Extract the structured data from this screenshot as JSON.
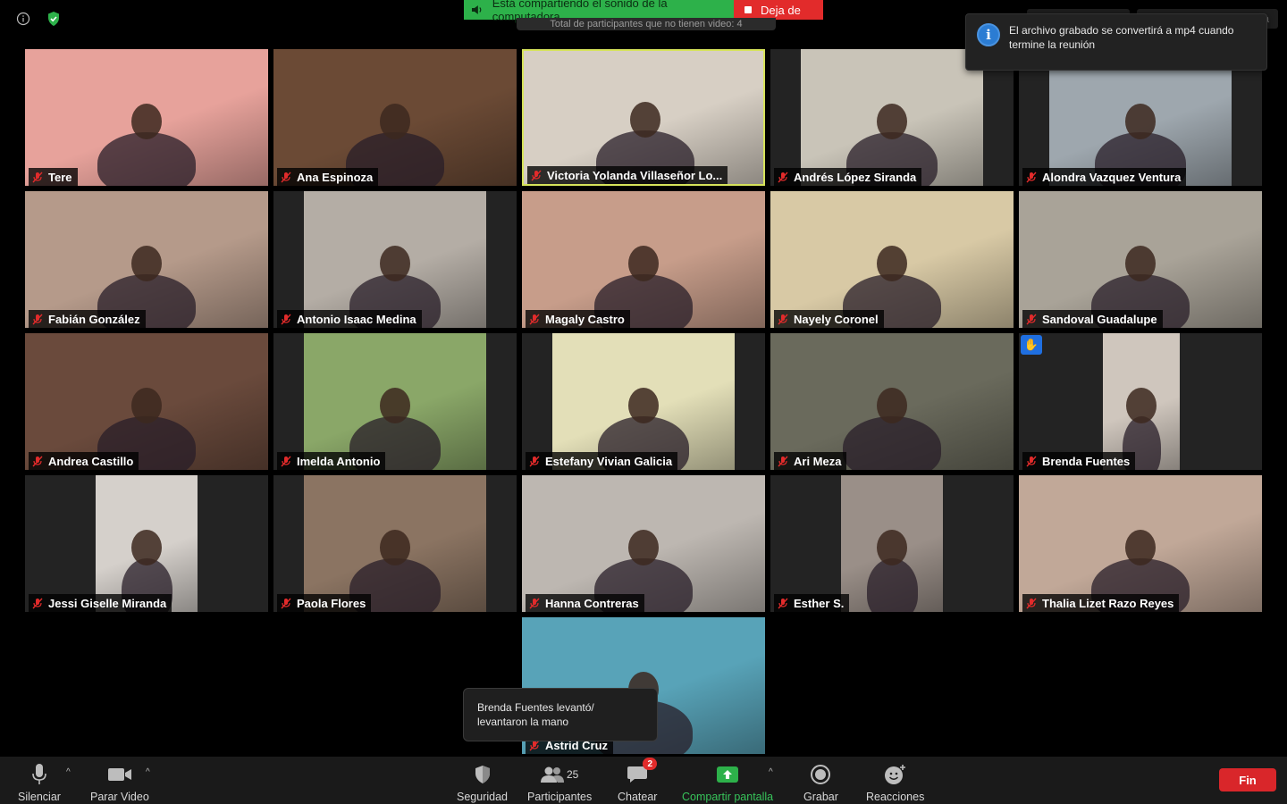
{
  "banner": {
    "sharing_text": "Está compartiendo el sonido de la computadora",
    "stop_label": "Deja de",
    "participants_ribbon": "Total de participantes que no tienen video: 4"
  },
  "top_right": {
    "speaker_view": "Vista del hablante",
    "exit_fullscreen": "Salir de pantalla completa"
  },
  "toast": {
    "message": "El archivo grabado se convertirá a mp4 cuando termine la reunión"
  },
  "hand_notification": {
    "message": "Brenda Fuentes levantó/ levantaron la mano"
  },
  "participants": [
    {
      "name": "Tere",
      "bg": "#e7a29b",
      "active": false,
      "hand": false
    },
    {
      "name": "Ana Espinoza",
      "bg": "#6b4a35",
      "active": false,
      "hand": false
    },
    {
      "name": "Victoria Yolanda Villaseñor Lo...",
      "bg": "#d7cfc4",
      "active": true,
      "hand": false
    },
    {
      "name": "Andrés López Siranda",
      "bg": "#c9c4b8",
      "active": false,
      "hand": false
    },
    {
      "name": "Alondra Vazquez Ventura",
      "bg": "#9ea7ae",
      "active": false,
      "hand": false
    },
    {
      "name": "Fabián González",
      "bg": "#b59a8a",
      "active": false,
      "hand": false
    },
    {
      "name": "Antonio Isaac Medina",
      "bg": "#b4ada5",
      "active": false,
      "hand": false
    },
    {
      "name": "Magaly Castro",
      "bg": "#c79d8a",
      "active": false,
      "hand": false
    },
    {
      "name": "Nayely Coronel",
      "bg": "#d8c9a5",
      "active": false,
      "hand": false
    },
    {
      "name": "Sandoval Guadalupe",
      "bg": "#a9a398",
      "active": false,
      "hand": false
    },
    {
      "name": "Andrea Castillo",
      "bg": "#6a4a3c",
      "active": false,
      "hand": false
    },
    {
      "name": "Imelda Antonio",
      "bg": "#8aa768",
      "active": false,
      "hand": false
    },
    {
      "name": "Estefany Vivian Galicia",
      "bg": "#e3dfb8",
      "active": false,
      "hand": false
    },
    {
      "name": "Ari Meza",
      "bg": "#6a6a5c",
      "active": false,
      "hand": false
    },
    {
      "name": "Brenda Fuentes",
      "bg": "#cfc6bd",
      "active": false,
      "hand": true
    },
    {
      "name": "Jessi Giselle Miranda",
      "bg": "#d5d0cb",
      "active": false,
      "hand": false
    },
    {
      "name": "Paola Flores",
      "bg": "#8b7462",
      "active": false,
      "hand": false
    },
    {
      "name": "Hanna Contreras",
      "bg": "#bdb7b1",
      "active": false,
      "hand": false
    },
    {
      "name": "Esther S.",
      "bg": "#9a8f88",
      "active": false,
      "hand": false
    },
    {
      "name": "Thalia Lizet Razo Reyes",
      "bg": "#c1a898",
      "active": false,
      "hand": false
    },
    {
      "name": "Astrid Cruz",
      "bg": "#58a3b8",
      "active": false,
      "hand": false
    }
  ],
  "toolbar": {
    "mute": "Silenciar",
    "stop_video": "Parar Video",
    "security": "Seguridad",
    "participants": "Participantes",
    "participants_count": "25",
    "chat": "Chatear",
    "chat_badge": "2",
    "share_screen": "Compartir pantalla",
    "record": "Grabar",
    "reactions": "Reacciones",
    "end": "Fin"
  },
  "colors": {
    "share_green": "#2db14a",
    "stop_red": "#e22b2b",
    "active_speaker": "#d6e35a",
    "end_button": "#d9262a",
    "hand_blue": "#1f6fe0"
  }
}
